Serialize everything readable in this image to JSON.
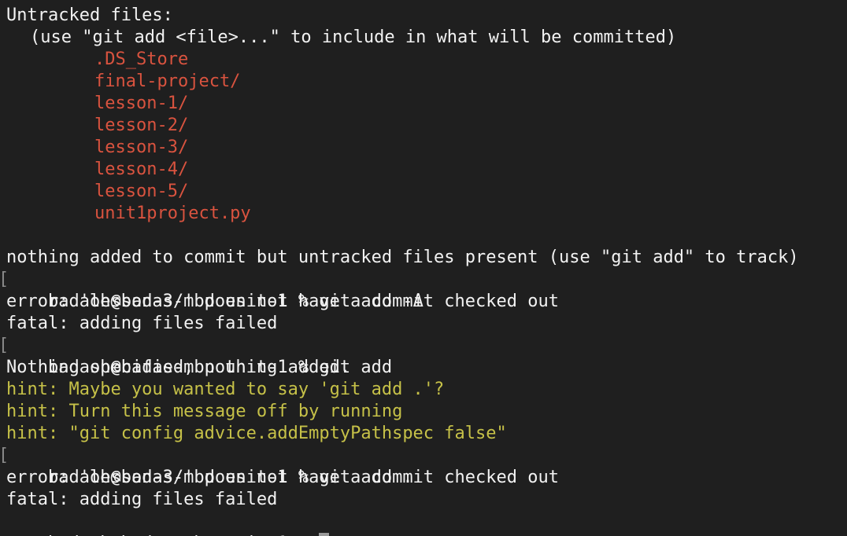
{
  "terminal": {
    "colors": {
      "background": "#1f1f1f",
      "text": "#f2f2f2",
      "untracked": "#d9533f",
      "hint": "#c6c148",
      "cursor": "#9a9a9a"
    },
    "untracked_header": "Untracked files:",
    "untracked_instruction": "(use \"git add <file>...\" to include in what will be committed)",
    "untracked_files": [
      ".DS_Store",
      "final-project/",
      "lesson-1/",
      "lesson-2/",
      "lesson-3/",
      "lesson-4/",
      "lesson-5/",
      "unit1project.py"
    ],
    "status_summary": "nothing added to commit but untracked files present (use \"git add\" to track)",
    "prompt": "badaoh@badas-mbp unit-1 % ",
    "commands": [
      "git add -A",
      "git add",
      "git add ."
    ],
    "errors": [
      "error: 'lesson-3/' does not have a commit checked out",
      "fatal: adding files failed",
      "Nothing specified, nothing added."
    ],
    "hints": [
      "hint: Maybe you wanted to say 'git add .'?",
      "hint: Turn this message off by running",
      "hint: \"git config advice.addEmptyPathspec false\""
    ],
    "prompt_marker": "["
  }
}
